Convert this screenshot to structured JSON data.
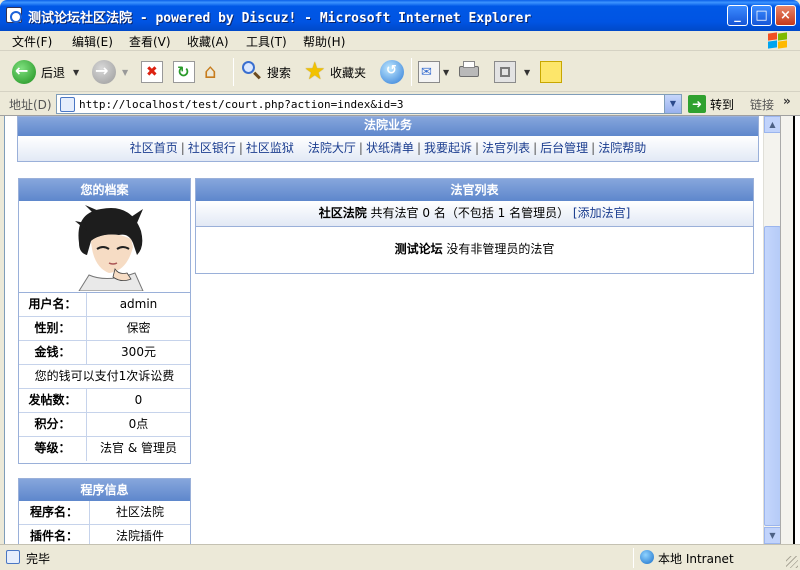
{
  "window": {
    "title": "测试论坛社区法院 - powered by Discuz! - Microsoft Internet Explorer",
    "minimize": "_",
    "maximize": "□",
    "close": "×"
  },
  "menu": [
    {
      "label": "文件(F)"
    },
    {
      "label": "编辑(E)"
    },
    {
      "label": "查看(V)"
    },
    {
      "label": "收藏(A)"
    },
    {
      "label": "工具(T)"
    },
    {
      "label": "帮助(H)"
    }
  ],
  "toolbar": {
    "back_label": "后退",
    "search_label": "搜索",
    "favorites_label": "收藏夹"
  },
  "address": {
    "label": "地址(D)",
    "url": "http://localhost/test/court.php?action=index&id=3",
    "go_label": "转到",
    "links_label": "链接",
    "more": "»"
  },
  "page": {
    "section_title": "法院业务",
    "nav": [
      "社区首页",
      "社区银行",
      "社区监狱",
      "法院大厅",
      "状纸清单",
      "我要起诉",
      "法官列表",
      "后台管理",
      "法院帮助"
    ],
    "profile": {
      "title": "您的档案",
      "rows": [
        {
          "k": "用户名：",
          "v": "admin"
        },
        {
          "k": "性别：",
          "v": "保密"
        },
        {
          "k": "金钱：",
          "v": "300元"
        }
      ],
      "note": "您的钱可以支付1次诉讼费",
      "rows2": [
        {
          "k": "发帖数：",
          "v": "0"
        },
        {
          "k": "积分：",
          "v": "0点"
        },
        {
          "k": "等级：",
          "v": "法官 & 管理员"
        }
      ]
    },
    "program": {
      "title": "程序信息",
      "rows": [
        {
          "k": "程序名：",
          "v": "社区法院"
        },
        {
          "k": "插件名：",
          "v": "法院插件"
        }
      ]
    },
    "judges": {
      "title": "法官列表",
      "court_name": "社区法院",
      "summary": " 共有法官 0 名（不包括 1 名管理员）",
      "add_link": "[添加法官]",
      "forum_name": "测试论坛",
      "empty_text": " 没有非管理员的法官"
    }
  },
  "status": {
    "text": "完毕",
    "zone": "本地 Intranet"
  }
}
